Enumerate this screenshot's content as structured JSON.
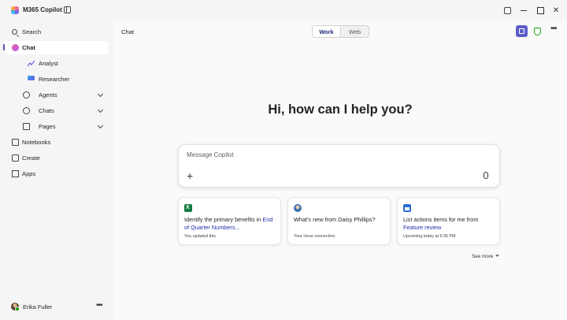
{
  "app": {
    "title": "M365 Copilot"
  },
  "sidebar": {
    "items": [
      {
        "label": "Search",
        "icon": "search-icon"
      },
      {
        "label": "Chat",
        "icon": "chat-icon",
        "active": true
      },
      {
        "label": "Analyst",
        "icon": "analyst-icon"
      },
      {
        "label": "Researcher",
        "icon": "researcher-icon"
      },
      {
        "label": "Agents",
        "icon": "agents-icon",
        "expandable": true
      },
      {
        "label": "Chats",
        "icon": "chats-icon",
        "expandable": true
      },
      {
        "label": "Pages",
        "icon": "pages-icon",
        "expandable": true
      },
      {
        "label": "Notebooks",
        "icon": "notebook-icon"
      },
      {
        "label": "Create",
        "icon": "create-icon"
      },
      {
        "label": "Apps",
        "icon": "apps-icon"
      }
    ],
    "user": {
      "name": "Erika Fuller",
      "more": "•••"
    }
  },
  "main": {
    "title": "Chat",
    "toggle": {
      "options": [
        "Work",
        "Web"
      ],
      "selected": "Work"
    },
    "greeting": "Hi, how can I help you?",
    "composer": {
      "placeholder": "Message Copilot",
      "plus": "+"
    },
    "cards": [
      {
        "icon": "excel-icon",
        "text_plain": "Identify the primary benefits in ",
        "text_link": "End of Quarter Numbers...",
        "sub": "You updated this"
      },
      {
        "icon": "person-icon",
        "text_plain": "What's new from Daisy Phillips?",
        "text_link": "",
        "sub": "Your close connection"
      },
      {
        "icon": "calendar-icon",
        "text_plain": "List actions items for me from ",
        "text_link": "Feature review",
        "sub": "Upcoming today at 9:35 PM"
      }
    ],
    "see_more": "See more"
  },
  "colors": {
    "accent": "#5b5fc7",
    "link": "#1f2fa8",
    "active_indicator": "#4f52b2",
    "shield": "#13a10e"
  }
}
